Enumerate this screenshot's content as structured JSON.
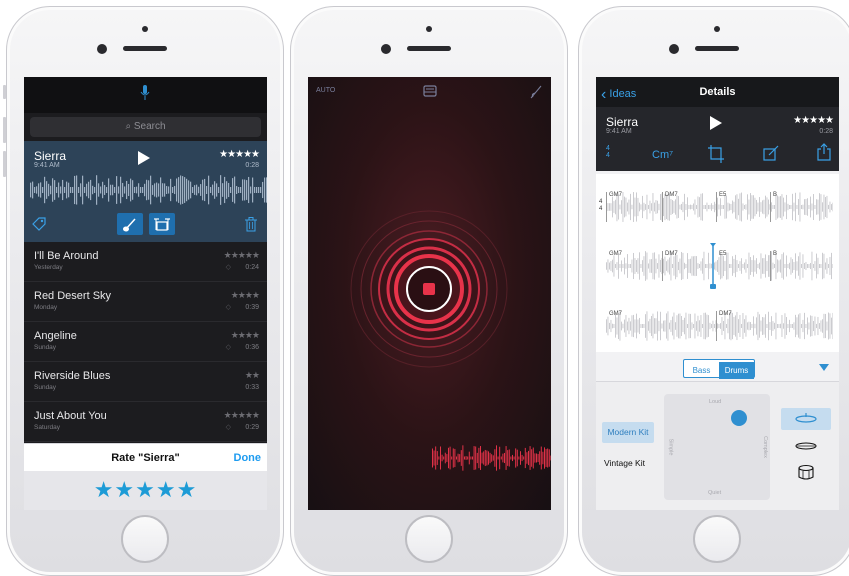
{
  "screen1": {
    "search_placeholder": "Search",
    "selected": {
      "title": "Sierra",
      "time": "9:41 AM",
      "rating": "★★★★★",
      "duration": "0:28"
    },
    "recordings": [
      {
        "title": "I'll Be Around",
        "date": "Yesterday",
        "rating": "★★★★★",
        "duration": "0:24"
      },
      {
        "title": "Red Desert Sky",
        "date": "Monday",
        "rating": "★★★★",
        "duration": "0:39"
      },
      {
        "title": "Angeline",
        "date": "Sunday",
        "rating": "★★★★",
        "duration": "0:36"
      },
      {
        "title": "Riverside Blues",
        "date": "Sunday",
        "rating": "★★",
        "duration": "0:33"
      },
      {
        "title": "Just About You",
        "date": "Saturday",
        "rating": "★★★★★",
        "duration": "0:29"
      }
    ],
    "rate_title": "Rate \"Sierra\"",
    "rate_done": "Done",
    "rate_stars": "★★★★★"
  },
  "screen2": {
    "auto_label": "AUTO",
    "accent": "#e8334a"
  },
  "screen3": {
    "back_label": "Ideas",
    "nav_title": "Details",
    "title": "Sierra",
    "time": "9:41 AM",
    "rating": "★★★★★",
    "duration": "0:28",
    "time_sig_top": "4",
    "time_sig_bottom": "4",
    "chord": "Cm⁷",
    "rows": [
      [
        "GM7",
        "DM7",
        "E5",
        "B"
      ],
      [
        "GM7",
        "DM7",
        "E5",
        "B"
      ],
      [
        "GM7",
        "DM7"
      ]
    ],
    "toggle": {
      "bass": "Bass",
      "drums": "Drums"
    },
    "kits": {
      "modern": "Modern Kit",
      "vintage": "Vintage Kit"
    },
    "pad_labels": {
      "top": "Loud",
      "bottom": "Quiet",
      "left": "Simple",
      "right": "Complex"
    },
    "accent": "#2f8fd0"
  }
}
